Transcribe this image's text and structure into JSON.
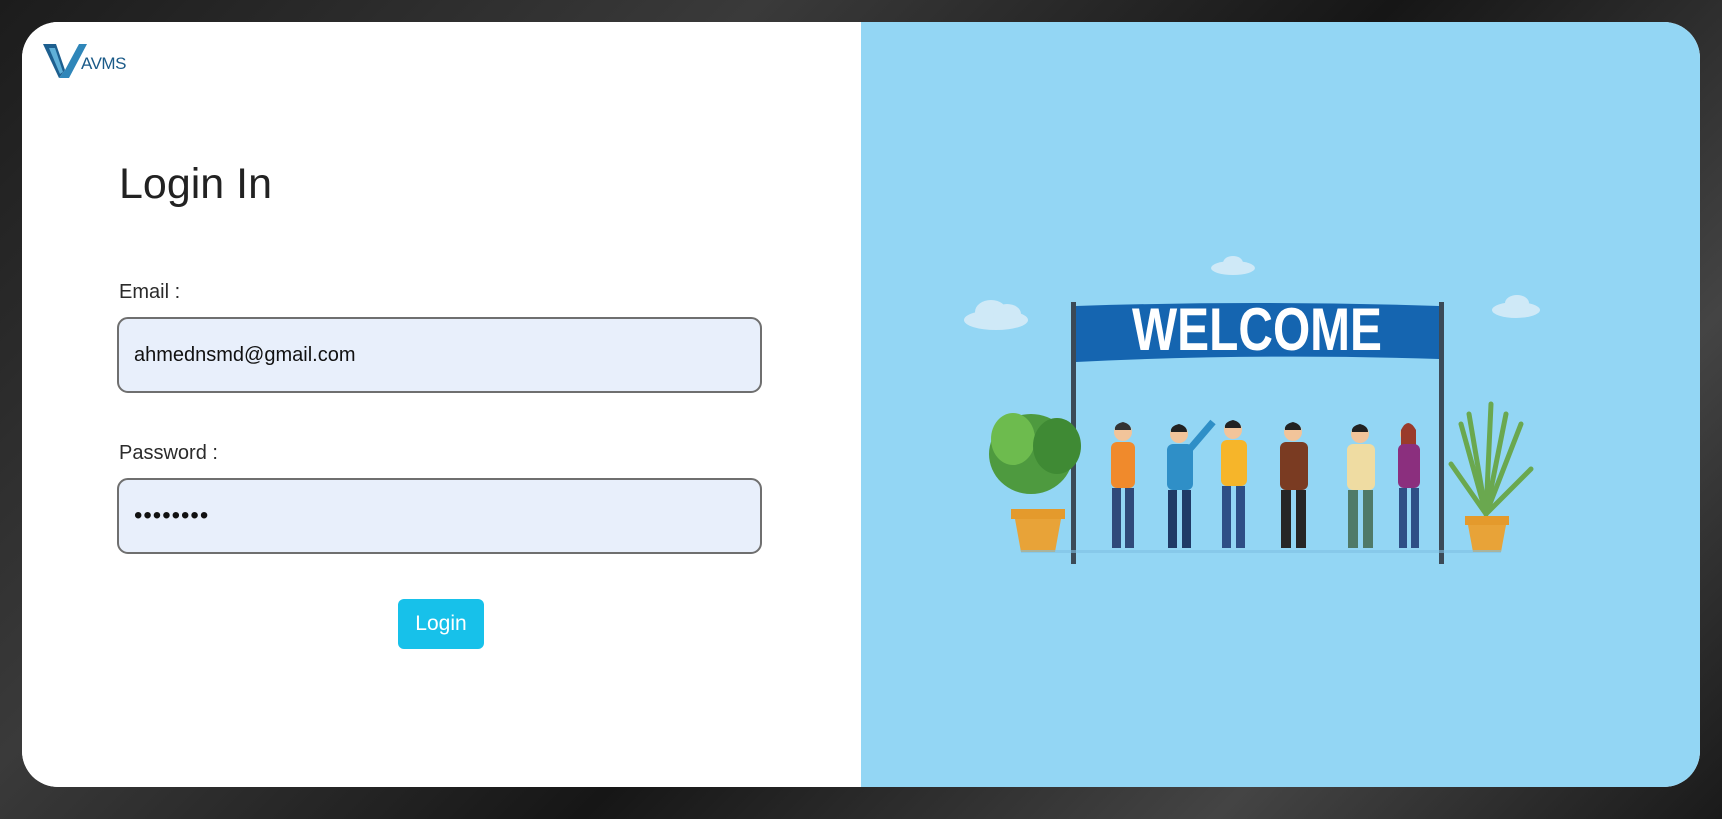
{
  "brand": {
    "logo_text": "AVMS"
  },
  "login": {
    "title": "Login In",
    "email_label": "Email :",
    "email_value": "ahmednsmd@gmail.com",
    "password_label": "Password :",
    "password_value": "mypasswd",
    "button_label": "Login"
  },
  "illustration": {
    "banner_text": "WELCOME"
  },
  "colors": {
    "button": "#17c1ea",
    "panel_background": "#93d6f4",
    "banner": "#1565b0",
    "input_background": "#e8effb"
  }
}
